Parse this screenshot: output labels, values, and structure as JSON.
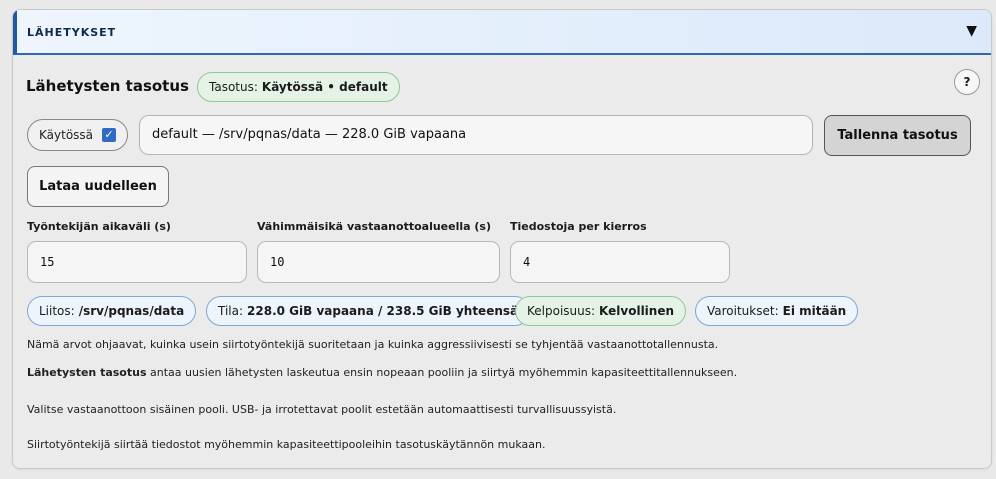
{
  "panel": {
    "title": "LÄHETYKSET",
    "collapse_icon": "triangle-down-icon"
  },
  "tiering": {
    "title": "Lähetysten tasotus",
    "status_label": "Tasotus:",
    "status_value": "Käytössä • default",
    "help_label": "?",
    "enabled_label": "Käytössä",
    "enabled_checked": true,
    "pool_value": "default — /srv/pqnas/data — 228.0 GiB vapaana",
    "save_label": "Tallenna tasotus",
    "reload_label": "Lataa uudelleen"
  },
  "fields": [
    {
      "label": "Työntekijän aikaväli (s)",
      "value": "15"
    },
    {
      "label": "Vähimmäisikä vastaanottoalueella (s)",
      "value": "10"
    },
    {
      "label": "Tiedostoja per kierros",
      "value": "4"
    }
  ],
  "badges": [
    {
      "label": "Liitos:",
      "value": "/srv/pqnas/data",
      "tone": "blue"
    },
    {
      "label": "Tila:",
      "value": "228.0 GiB vapaana / 238.5 GiB yhteensä",
      "tone": "blue"
    },
    {
      "label": "Kelpoisuus:",
      "value": "Kelvollinen",
      "tone": "green"
    },
    {
      "label": "Varoitukset:",
      "value": "Ei mitään",
      "tone": "blue"
    }
  ],
  "info": {
    "line1": "Nämä arvot ohjaavat, kuinka usein siirtotyöntekijä suoritetaan ja kuinka aggressiivisesti se tyhjentää vastaanottotallennusta.",
    "line2_bold": "Lähetysten tasotus",
    "line2_rest": " antaa uusien lähetysten laskeutua ensin nopeaan pooliin ja siirtyä myöhemmin kapasiteettitallennukseen.",
    "line3": "Valitse vastaanottoon sisäinen pooli. USB- ja irrotettavat poolit estetään automaattisesti turvallisuussyistä.",
    "line4": "Siirtotyöntekijä siirtää tiedostot myöhemmin kapasiteettipooleihin tasotuskäytännön mukaan."
  },
  "colors": {
    "accent": "#1f5aa0",
    "badge_blue_border": "#7da7d9",
    "badge_green_border": "#8fc79b",
    "checkbox": "#2e6cc4"
  }
}
